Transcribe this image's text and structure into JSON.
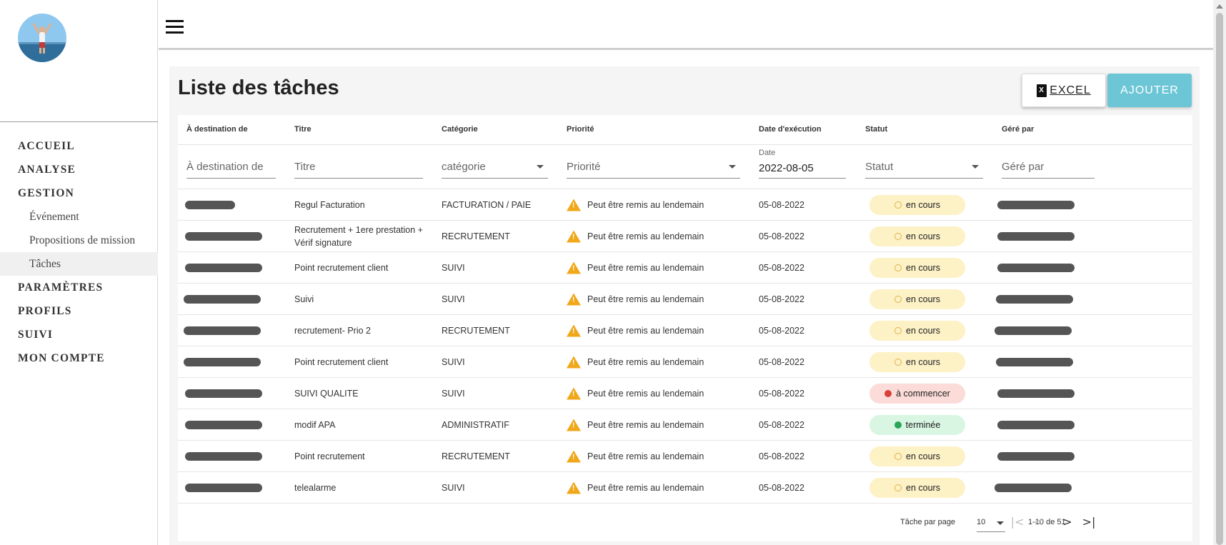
{
  "sidebar": {
    "nav": [
      {
        "label": "ACCUEIL",
        "type": "top"
      },
      {
        "label": "ANALYSE",
        "type": "top"
      },
      {
        "label": "GESTION",
        "type": "top"
      },
      {
        "label": "Événement",
        "type": "sub"
      },
      {
        "label": "Propositions de mission",
        "type": "sub"
      },
      {
        "label": "Tâches",
        "type": "sub",
        "active": true
      },
      {
        "label": "PARAMÈTRES",
        "type": "top"
      },
      {
        "label": "PROFILS",
        "type": "top"
      },
      {
        "label": "SUIVI",
        "type": "top"
      },
      {
        "label": "MON COMPTE",
        "type": "top"
      }
    ]
  },
  "page": {
    "title": "Liste des tâches",
    "excel_label": "EXCEL",
    "add_label": "AJOUTER"
  },
  "table": {
    "headers": [
      "À destination de",
      "Titre",
      "Catégorie",
      "Priorité",
      "Date d'exécution",
      "Statut",
      "Géré par"
    ],
    "filters": {
      "destination_placeholder": "À destination de",
      "titre_placeholder": "Titre",
      "categorie_placeholder": "catégorie",
      "priorite_placeholder": "Priorité",
      "date_label": "Date",
      "date_value": "2022-08-05",
      "statut_placeholder": "Statut",
      "gere_placeholder": "Géré par"
    },
    "rows": [
      {
        "titre": "Regul Facturation",
        "categorie": "FACTURATION / PAIE",
        "priorite": "Peut être remis au lendemain",
        "date": "05-08-2022",
        "statut": "en cours",
        "statut_type": "pending"
      },
      {
        "titre": "Recrutement + 1ere prestation + Vérif signature",
        "categorie": "RECRUTEMENT",
        "priorite": "Peut être remis au lendemain",
        "date": "05-08-2022",
        "statut": "en cours",
        "statut_type": "pending"
      },
      {
        "titre": "Point recrutement client",
        "categorie": "SUIVI",
        "priorite": "Peut être remis au lendemain",
        "date": "05-08-2022",
        "statut": "en cours",
        "statut_type": "pending"
      },
      {
        "titre": "Suivi",
        "categorie": "SUIVI",
        "priorite": "Peut être remis au lendemain",
        "date": "05-08-2022",
        "statut": "en cours",
        "statut_type": "pending"
      },
      {
        "titre": "recrutement- Prio 2",
        "categorie": "RECRUTEMENT",
        "priorite": "Peut être remis au lendemain",
        "date": "05-08-2022",
        "statut": "en cours",
        "statut_type": "pending"
      },
      {
        "titre": "Point recrutement client",
        "categorie": "SUIVI",
        "priorite": "Peut être remis au lendemain",
        "date": "05-08-2022",
        "statut": "en cours",
        "statut_type": "pending"
      },
      {
        "titre": "SUIVI QUALITE",
        "categorie": "SUIVI",
        "priorite": "Peut être remis au lendemain",
        "date": "05-08-2022",
        "statut": "à commencer",
        "statut_type": "todo"
      },
      {
        "titre": "modif APA",
        "categorie": "ADMINISTRATIF",
        "priorite": "Peut être remis au lendemain",
        "date": "05-08-2022",
        "statut": "terminée",
        "statut_type": "done"
      },
      {
        "titre": "Point recrutement",
        "categorie": "RECRUTEMENT",
        "priorite": "Peut être remis au lendemain",
        "date": "05-08-2022",
        "statut": "en cours",
        "statut_type": "pending"
      },
      {
        "titre": "telealarme",
        "categorie": "SUIVI",
        "priorite": "Peut être remis au lendemain",
        "date": "05-08-2022",
        "statut": "en cours",
        "statut_type": "pending"
      }
    ]
  },
  "pagination": {
    "per_page_label": "Tâche par page",
    "per_page_value": "10",
    "range": "1-10 de 51"
  },
  "colors": {
    "pending_bg": "#fdf1c6",
    "todo_bg": "#fbdcd9",
    "done_bg": "#d9f6e3",
    "accent": "#6cc6d6"
  }
}
